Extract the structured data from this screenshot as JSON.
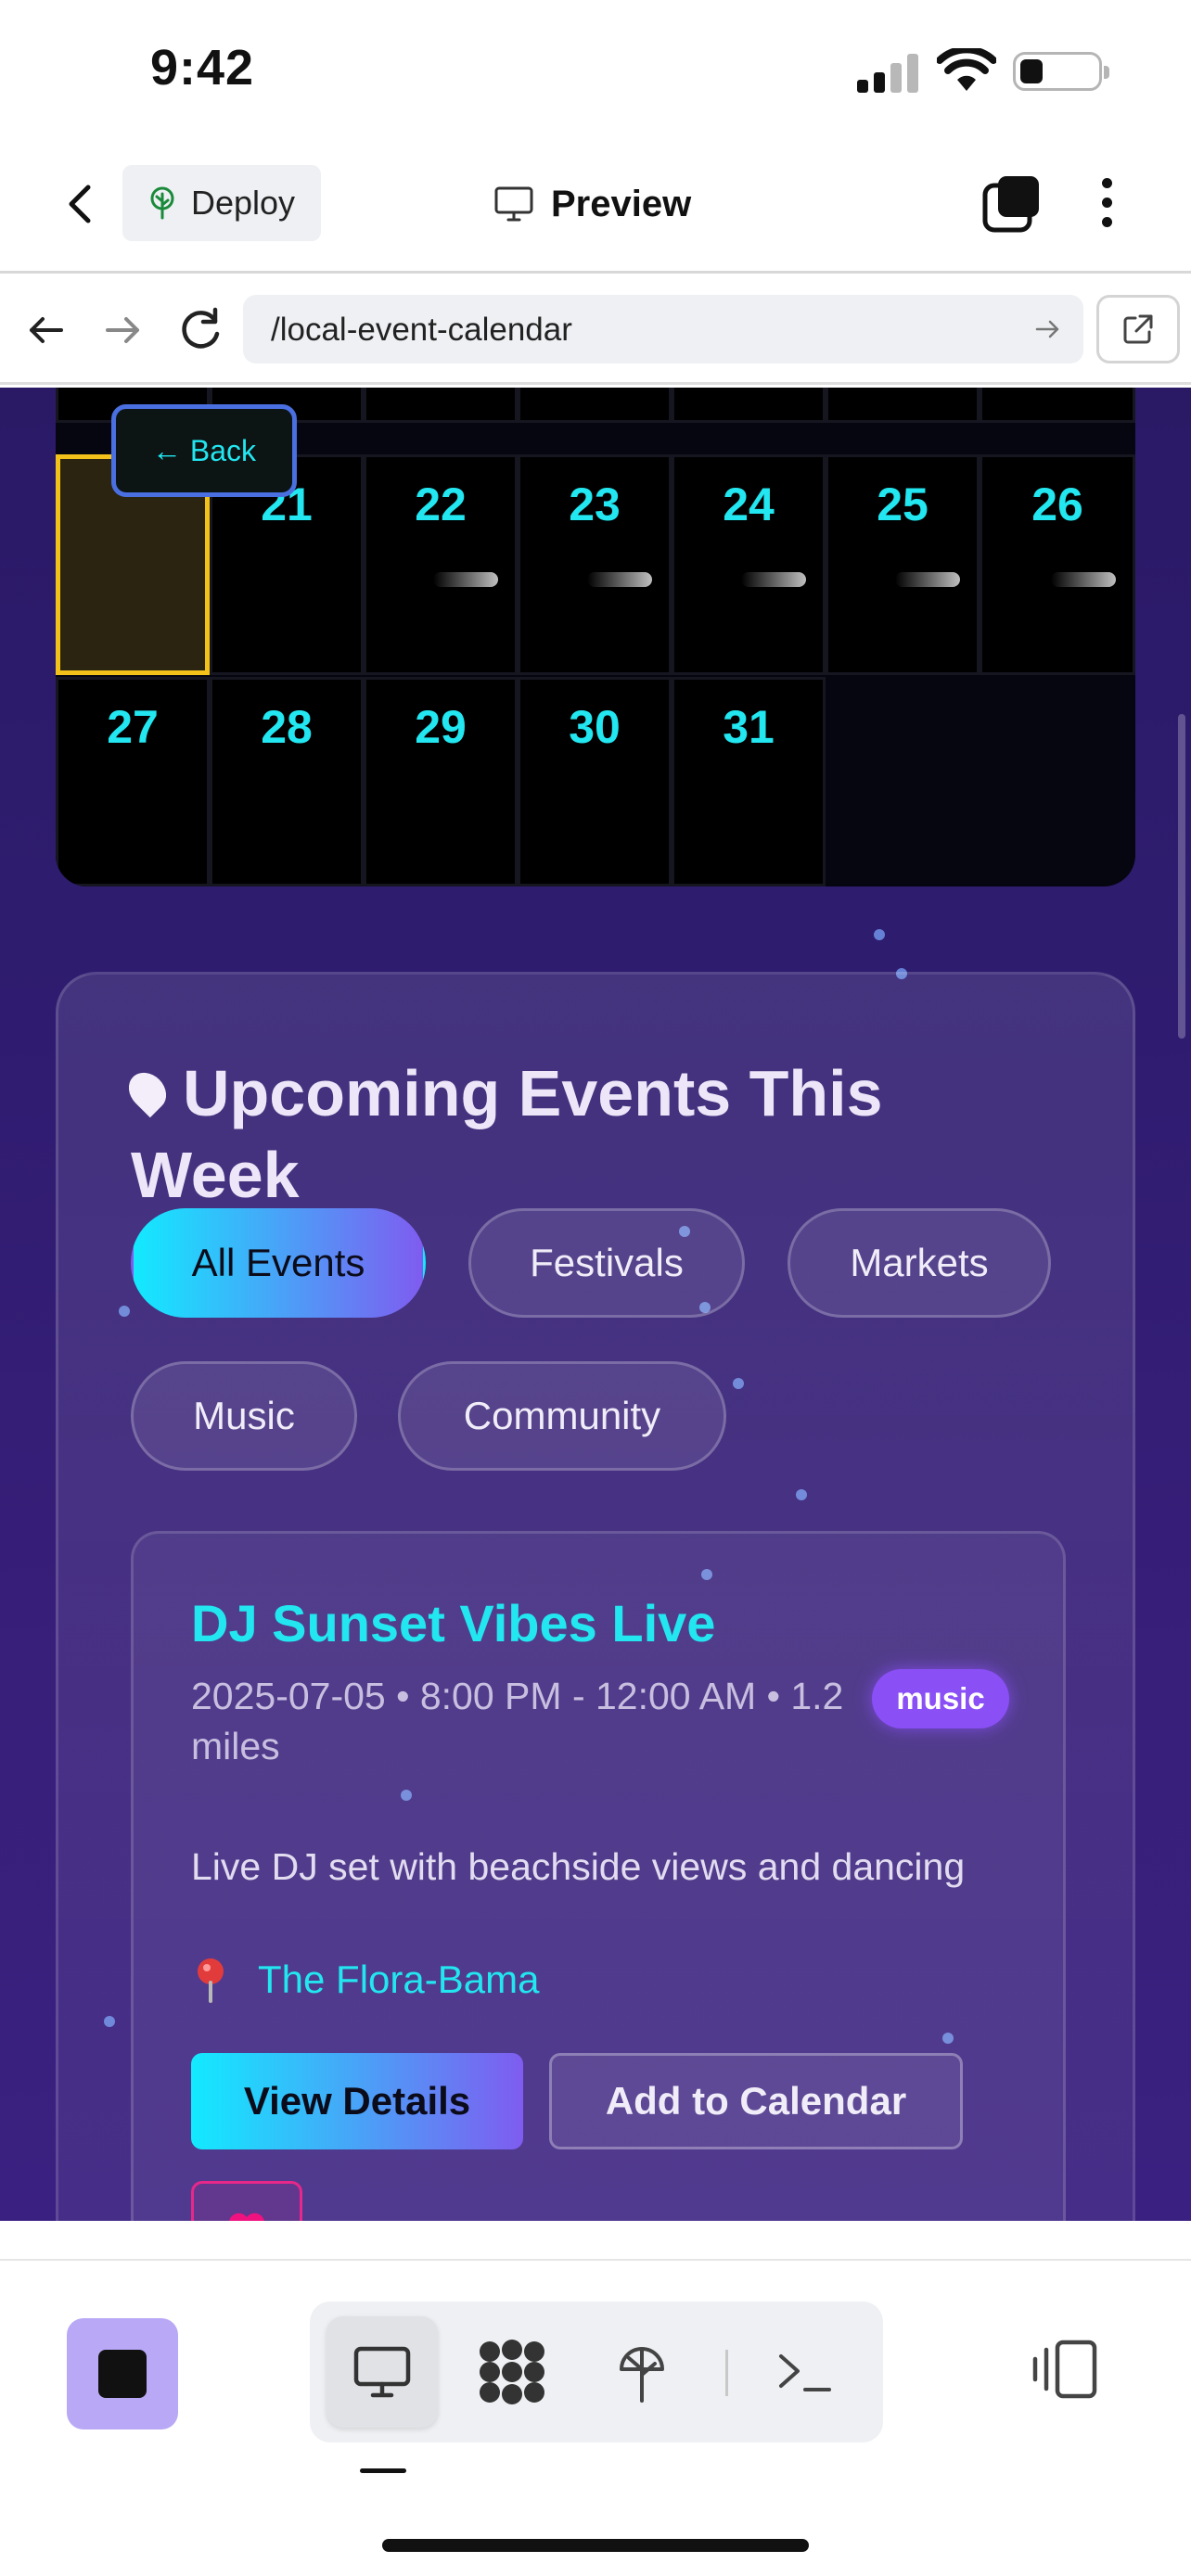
{
  "status_bar": {
    "time": "9:42"
  },
  "app_header": {
    "deploy_label": "Deploy",
    "preview_label": "Preview"
  },
  "browser": {
    "url": "/local-event-calendar"
  },
  "calendar": {
    "back_label": "← Back",
    "week4": [
      "",
      "21",
      "22",
      "23",
      "24",
      "25",
      "26"
    ],
    "week5": [
      "27",
      "28",
      "29",
      "30",
      "31"
    ]
  },
  "events": {
    "title": "Upcoming Events This Week",
    "filters": [
      "All Events",
      "Festivals",
      "Markets",
      "Music",
      "Community"
    ],
    "active_filter": "All Events",
    "cards": [
      {
        "title": "DJ Sunset Vibes Live",
        "meta": "2025-07-05 • 8:00 PM - 12:00 AM • 1.2 miles",
        "tag": "music",
        "description": "Live DJ set with beachside views and dancing",
        "venue": "The Flora-Bama",
        "details_label": "View Details",
        "calendar_label": "Add to Calendar"
      }
    ]
  },
  "colors": {
    "accent_cyan": "#22e6f0",
    "accent_purple": "#7f5cf0",
    "today_outline": "#f2c21b",
    "tag_music": "#8a4ff5",
    "favorite_pink": "#e7288a",
    "page_bg": "#2f1c70"
  },
  "icons": {
    "header": [
      "chevron-left-icon",
      "deploy-tree-icon",
      "monitor-icon",
      "tabs-icon",
      "more-vertical-icon"
    ],
    "toolbar": [
      "stop-icon",
      "monitor-icon",
      "apps-grid-icon",
      "deploy-tree-icon",
      "terminal-icon",
      "split-view-icon"
    ]
  }
}
